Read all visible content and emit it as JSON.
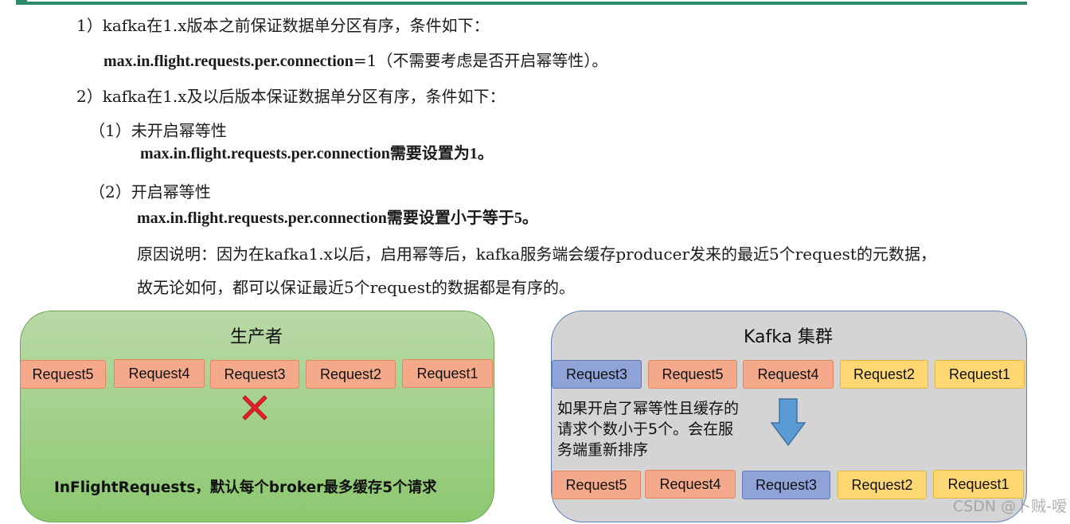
{
  "text": {
    "line1": "1）kafka在1.x版本之前保证数据单分区有序，条件如下：",
    "line2_bold": "max.in.flight.requests.per.connection",
    "line2_rest": "=1（不需要考虑是否开启幂等性）。",
    "line3": "2）kafka在1.x及以后版本保证数据单分区有序，条件如下：",
    "line4": "（1）未开启幂等性",
    "line5": "max.in.flight.requests.per.connection需要设置为1。",
    "line6": "（2）开启幂等性",
    "line7": "max.in.flight.requests.per.connection需要设置小于等于5。",
    "line8": "原因说明：因为在kafka1.x以后，启用幂等后，kafka服务端会缓存producer发来的最近5个request的元数据，",
    "line9": "故无论如何，都可以保证最近5个request的数据都是有序的。"
  },
  "producer": {
    "title": "生产者",
    "requests": [
      "Request5",
      "Request4",
      "Request3",
      "Request2",
      "Request1"
    ],
    "caption": "InFlightRequests，默认每个broker最多缓存5个请求"
  },
  "cluster": {
    "title": "Kafka 集群",
    "top_requests": [
      "Request3",
      "Request5",
      "Request4",
      "Request2",
      "Request1"
    ],
    "note": "如果开启了幂等性且缓存的\n请求个数小于5个。会在服\n务端重新排序",
    "bottom_requests": [
      "Request5",
      "Request4",
      "Request3",
      "Request2",
      "Request1"
    ]
  },
  "watermark": "CSDN @卜贼-嗳",
  "colors": {
    "accent_line": "#2e8b6a",
    "producer_panel": "#a7d08e",
    "cluster_panel": "#d4d4d4",
    "request_salmon": "#f3a98a",
    "request_blue": "#8fa3d8",
    "request_yellow": "#ffd874",
    "cross": "#e8202a",
    "arrow": "#5b9bd5"
  },
  "icons": {
    "cross": "red-x-icon",
    "arrow": "down-arrow-icon"
  }
}
